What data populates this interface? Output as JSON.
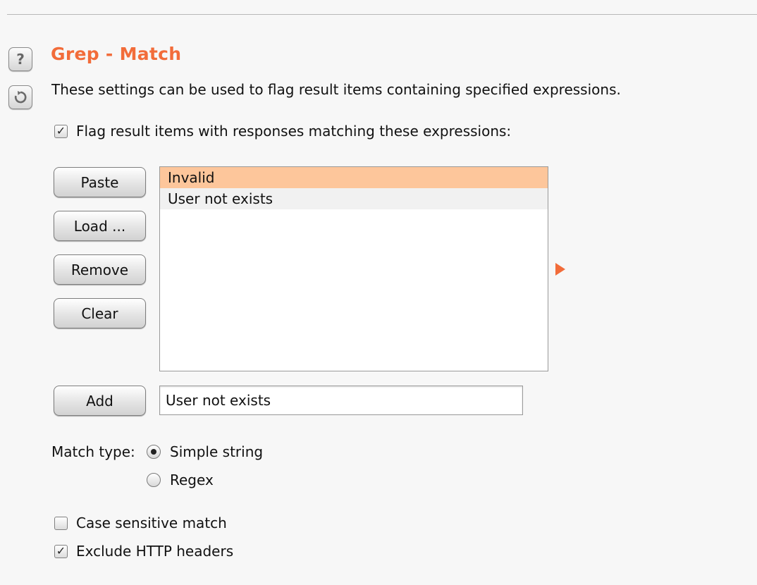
{
  "section": {
    "title": "Grep - Match",
    "description": "These settings can be used to flag result items containing specified expressions."
  },
  "icons": {
    "help": "help-icon",
    "reset": "reset-icon"
  },
  "flag_option": {
    "label": "Flag result items with responses matching these expressions:",
    "checked": true
  },
  "buttons": {
    "paste": "Paste",
    "load": "Load ...",
    "remove": "Remove",
    "clear": "Clear",
    "add": "Add"
  },
  "expressions": {
    "items": [
      "Invalid",
      "User not exists"
    ],
    "selected_index": 0
  },
  "add_input": {
    "value": "User not exists"
  },
  "match_type": {
    "label": "Match type:",
    "options": [
      "Simple string",
      "Regex"
    ],
    "selected": "Simple string"
  },
  "options": {
    "case_sensitive": {
      "label": "Case sensitive match",
      "checked": false
    },
    "exclude_headers": {
      "label": "Exclude HTTP headers",
      "checked": true
    }
  },
  "colors": {
    "accent": "#f26c3a",
    "selection": "#fdc69b"
  }
}
